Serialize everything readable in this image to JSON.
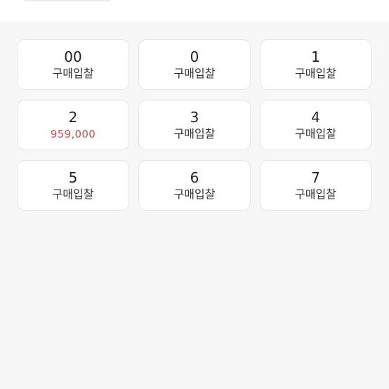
{
  "colors": {
    "background": "#f7f7f7",
    "card": "#ffffff",
    "price": "#c9524f"
  },
  "options": [
    {
      "size": "00",
      "sub": "구매입찰",
      "is_price": false
    },
    {
      "size": "0",
      "sub": "구매입찰",
      "is_price": false
    },
    {
      "size": "1",
      "sub": "구매입찰",
      "is_price": false
    },
    {
      "size": "2",
      "sub": "959,000",
      "is_price": true
    },
    {
      "size": "3",
      "sub": "구매입찰",
      "is_price": false
    },
    {
      "size": "4",
      "sub": "구매입찰",
      "is_price": false
    },
    {
      "size": "5",
      "sub": "구매입찰",
      "is_price": false
    },
    {
      "size": "6",
      "sub": "구매입찰",
      "is_price": false
    },
    {
      "size": "7",
      "sub": "구매입찰",
      "is_price": false
    }
  ]
}
